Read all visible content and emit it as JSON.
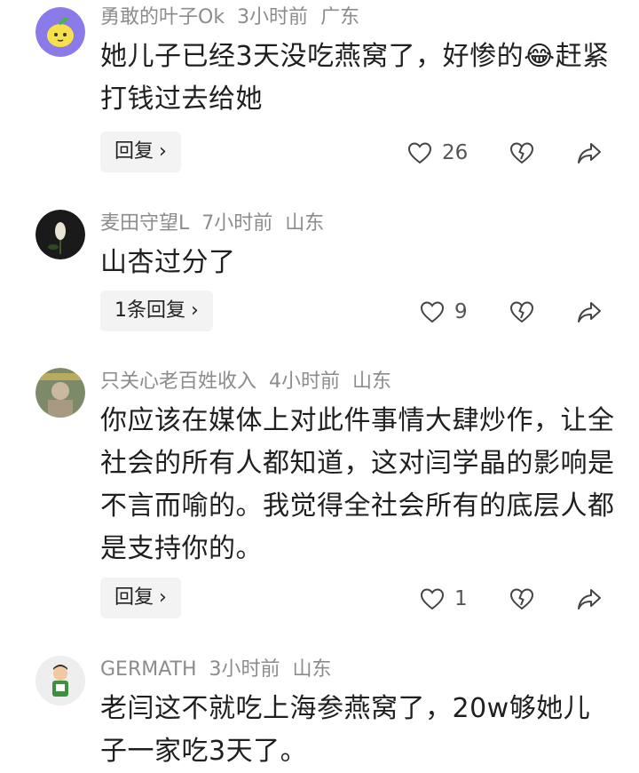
{
  "comments": [
    {
      "username": "勇敢的叶子Ok",
      "time": "3小时前",
      "location": "广东",
      "text": "她儿子已经3天没吃燕窝了，好惨的😂赶紧打钱过去给她",
      "reply_label": "回复",
      "likes": "26"
    },
    {
      "username": "麦田守望L",
      "time": "7小时前",
      "location": "山东",
      "text": "山杏过分了",
      "reply_label": "1条回复",
      "likes": "9"
    },
    {
      "username": "只关心老百姓收入",
      "time": "4小时前",
      "location": "山东",
      "text": "你应该在媒体上对此件事情大肆炒作，让全社会的所有人都知道，这对闫学晶的影响是不言而喻的。我觉得全社会所有的底层人都是支持你的。",
      "reply_label": "回复",
      "likes": "1"
    },
    {
      "username": "GERMATH",
      "time": "3小时前",
      "location": "山东",
      "text": "老闫这不就吃上海参燕窝了，20w够她儿子一家吃3天了。"
    }
  ],
  "icons": {
    "chevron": "›",
    "like": "heart-outline-icon",
    "dislike": "broken-heart-icon",
    "share": "share-arrow-icon"
  }
}
